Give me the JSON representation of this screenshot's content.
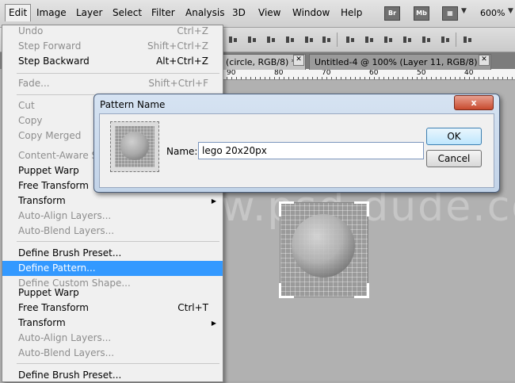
{
  "menubar": {
    "items": [
      {
        "label": "Edit",
        "active": true
      },
      {
        "label": "Image"
      },
      {
        "label": "Layer"
      },
      {
        "label": "Select"
      },
      {
        "label": "Filter"
      },
      {
        "label": "Analysis"
      },
      {
        "label": "3D"
      },
      {
        "label": "View"
      },
      {
        "label": "Window"
      },
      {
        "label": "Help"
      }
    ],
    "bridge_label": "Br",
    "minibridge_label": "Mb",
    "zoom": "600%"
  },
  "tabs": [
    {
      "label": "(circle, RGB/8) *"
    },
    {
      "label": "Untitled-4 @ 100% (Layer 11, RGB/8) *"
    }
  ],
  "ruler": {
    "numbers": [
      "90",
      "80",
      "70",
      "60",
      "50",
      "40"
    ]
  },
  "watermark": "www.psd-dude.com",
  "edit_menu": {
    "items": [
      {
        "label": "Undo",
        "shortcut": "Ctrl+Z",
        "disabled": true
      },
      {
        "label": "Step Forward",
        "shortcut": "Shift+Ctrl+Z",
        "disabled": true
      },
      {
        "label": "Step Backward",
        "shortcut": "Alt+Ctrl+Z"
      },
      {
        "label": "Fade...",
        "shortcut": "Shift+Ctrl+F",
        "disabled": true
      },
      {
        "label": "Cut",
        "disabled": true
      },
      {
        "label": "Copy",
        "disabled": true
      },
      {
        "label": "Copy Merged",
        "disabled": true
      },
      {
        "label": "Content-Aware Sc",
        "disabled": true
      },
      {
        "label": "Puppet Warp"
      },
      {
        "label": "Free Transform"
      },
      {
        "label": "Transform",
        "submenu": true
      },
      {
        "label": "Auto-Align Layers...",
        "disabled": true
      },
      {
        "label": "Auto-Blend Layers...",
        "disabled": true
      },
      {
        "label": "Define Brush Preset..."
      },
      {
        "label": "Define Pattern...",
        "highlighted": true
      },
      {
        "label": "Define Custom Shape...",
        "disabled": true
      },
      {
        "label": "Puppet Warp"
      },
      {
        "label": "Free Transform",
        "shortcut": "Ctrl+T"
      },
      {
        "label": "Transform",
        "submenu": true
      },
      {
        "label": "Auto-Align Layers...",
        "disabled": true
      },
      {
        "label": "Auto-Blend Layers...",
        "disabled": true
      },
      {
        "label": "Define Brush Preset..."
      }
    ]
  },
  "dialog": {
    "title": "Pattern Name",
    "close_label": "x",
    "name_label": "Name:",
    "name_value": "lego 20x20px",
    "ok_label": "OK",
    "cancel_label": "Cancel"
  },
  "colors": {
    "highlight": "#3399ff",
    "dialog_frame": "#c2d3e8"
  }
}
